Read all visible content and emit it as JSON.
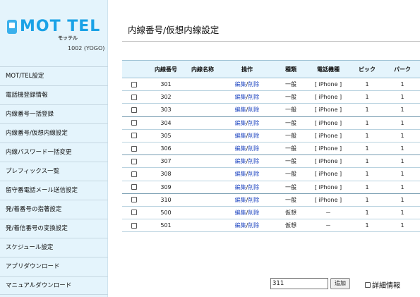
{
  "brand": {
    "logo_text": "MOT TEL",
    "logo_sub": "モッテル",
    "user_id": "1002 (YOGO)"
  },
  "menu": [
    "MOT/TEL設定",
    "電話機登録情報",
    "内線番号一括登録",
    "内線番号/仮想内線設定",
    "内線パスワード一括変更",
    "プレフィックス一覧",
    "留守番電話メール送信設定",
    "発/着番号の指著設定",
    "発/着信番号の変換設定",
    "スケジュール設定",
    "アプリダウンロード",
    "マニュアルダウンロード"
  ],
  "page": {
    "title": "内線番号/仮想内線設定"
  },
  "table": {
    "headers": [
      "",
      "内線番号",
      "内線名称",
      "操作",
      "種類",
      "電話機種",
      "ピック",
      "パーク"
    ],
    "edit_label": "編集",
    "slash": "/",
    "delete_label": "削除",
    "rows": [
      {
        "ext": "301",
        "name": "",
        "type": "一般",
        "model": "[ iPhone ]",
        "pick": "1",
        "park": "1"
      },
      {
        "ext": "302",
        "name": "",
        "type": "一般",
        "model": "[ iPhone ]",
        "pick": "1",
        "park": "1"
      },
      {
        "ext": "303",
        "name": "",
        "type": "一般",
        "model": "[ iPhone ]",
        "pick": "1",
        "park": "1"
      },
      {
        "ext": "304",
        "name": "",
        "type": "一般",
        "model": "[ iPhone ]",
        "pick": "1",
        "park": "1"
      },
      {
        "ext": "305",
        "name": "",
        "type": "一般",
        "model": "[ iPhone ]",
        "pick": "1",
        "park": "1"
      },
      {
        "ext": "306",
        "name": "",
        "type": "一般",
        "model": "[ iPhone ]",
        "pick": "1",
        "park": "1"
      },
      {
        "ext": "307",
        "name": "",
        "type": "一般",
        "model": "[ iPhone ]",
        "pick": "1",
        "park": "1"
      },
      {
        "ext": "308",
        "name": "",
        "type": "一般",
        "model": "[ iPhone ]",
        "pick": "1",
        "park": "1"
      },
      {
        "ext": "309",
        "name": "",
        "type": "一般",
        "model": "[ iPhone ]",
        "pick": "1",
        "park": "1"
      },
      {
        "ext": "310",
        "name": "",
        "type": "一般",
        "model": "[ iPhone ]",
        "pick": "1",
        "park": "1"
      },
      {
        "ext": "500",
        "name": "",
        "type": "仮想",
        "model": "－",
        "pick": "1",
        "park": "1"
      },
      {
        "ext": "501",
        "name": "",
        "type": "仮想",
        "model": "－",
        "pick": "1",
        "park": "1"
      }
    ]
  },
  "footer": {
    "input_value": "311",
    "add_label": "追加",
    "detail_label": "詳細情報"
  },
  "colors": {
    "brand_blue": "#1aa2e6",
    "sidebar_bg": "#e4f4fc",
    "link_blue": "#2a4fc4"
  }
}
